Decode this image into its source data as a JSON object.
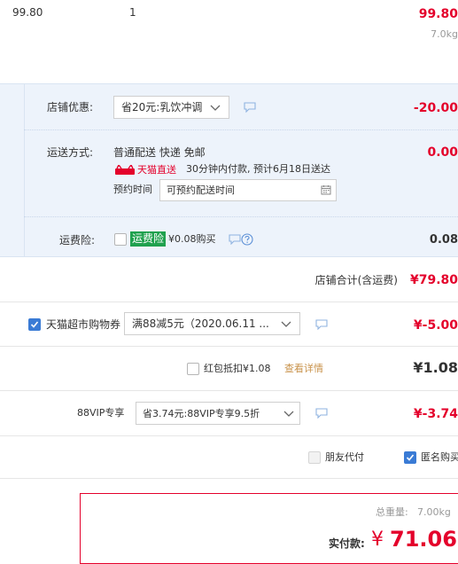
{
  "item": {
    "unit_price": "99.80",
    "quantity": "1",
    "subtotal": "99.80",
    "weight": "7.0kg"
  },
  "shop": {
    "discount_label": "店铺优惠:",
    "discount_select": "省20元:乳饮冲调",
    "discount_amount": "-20.00",
    "shipping_label": "运送方式:",
    "shipping_method": "普通配送 快递 免邮",
    "tmall_direct_badge": "天猫直送",
    "shipping_note": "30分钟内付款, 预计6月18日送达",
    "shipping_amount": "0.00",
    "appointment_label": "预约时间",
    "appointment_placeholder": "可预约配送时间",
    "insurance_label": "运费险:",
    "insurance_tag": "运费险",
    "insurance_price": "¥0.08购买",
    "insurance_amount": "0.08",
    "total_label": "店铺合计(含运费)",
    "total_amount": "¥79.80"
  },
  "coupon": {
    "label": "天猫超市购物券",
    "select": "满88减5元（2020.06.11 ...",
    "amount": "¥-5.00",
    "checked": true
  },
  "redpacket": {
    "label": "红包抵扣¥1.08",
    "detail_link": "查看详情",
    "amount": "¥1.08"
  },
  "vip": {
    "label": "88VIP专享",
    "select": "省3.74元:88VIP专享9.5折",
    "amount": "¥-3.74"
  },
  "options": {
    "friend_pay": "朋友代付",
    "anonymous": "匿名购买"
  },
  "summary": {
    "weight_label": "总重量:",
    "weight_value": "7.00kg",
    "pay_label": "实付款:",
    "currency": "¥",
    "pay_amount": "71.06"
  },
  "colors": {
    "accent_red": "#e4002b",
    "panel_blue": "#edf3fb",
    "checkbox_blue": "#3a7bd5",
    "tag_green": "#20a14e"
  }
}
